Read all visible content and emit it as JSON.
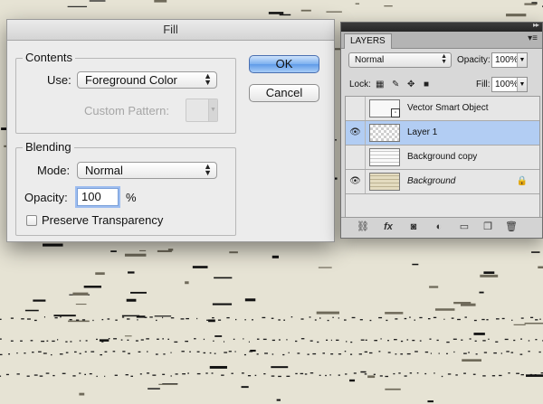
{
  "fill_dialog": {
    "title": "Fill",
    "contents": {
      "group_title": "Contents",
      "use_label": "Use:",
      "use_value": "Foreground Color",
      "custom_pattern_label": "Custom Pattern:"
    },
    "blending": {
      "group_title": "Blending",
      "mode_label": "Mode:",
      "mode_value": "Normal",
      "opacity_label": "Opacity:",
      "opacity_value": "100",
      "opacity_unit": "%",
      "preserve_transparency_label": "Preserve Transparency",
      "preserve_transparency_checked": false
    },
    "ok_label": "OK",
    "cancel_label": "Cancel"
  },
  "layers_panel": {
    "tab_label": "LAYERS",
    "menu_icon": "panel-menu-icon",
    "blend_mode": "Normal",
    "opacity_label": "Opacity:",
    "opacity_value": "100%",
    "lock_label": "Lock:",
    "fill_label": "Fill:",
    "fill_value": "100%",
    "layers": [
      {
        "name": "Vector Smart Object",
        "visible": false,
        "selected": false,
        "thumb": "smart-object",
        "locked": false
      },
      {
        "name": "Layer 1",
        "visible": true,
        "selected": true,
        "thumb": "transparent",
        "locked": false
      },
      {
        "name": "Background copy",
        "visible": false,
        "selected": false,
        "thumb": "background-copy",
        "locked": false
      },
      {
        "name": "Background",
        "visible": true,
        "selected": false,
        "thumb": "background",
        "locked": true
      }
    ],
    "footer_icons": [
      "link-icon",
      "fx-icon",
      "mask-icon",
      "adjustment-icon",
      "folder-icon",
      "new-layer-icon",
      "trash-icon"
    ]
  },
  "colors": {
    "selection_blue": "#b2cdf3",
    "default_button_blue": "#6fa6ec",
    "focus_ring": "#9dbdf0"
  }
}
